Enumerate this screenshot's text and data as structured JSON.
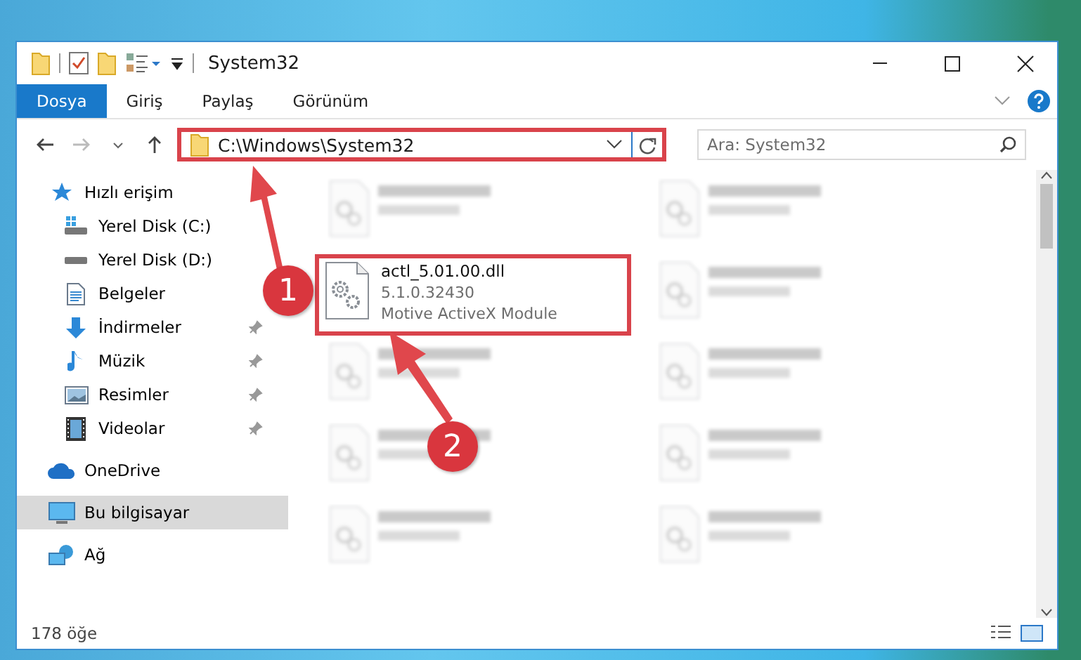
{
  "window": {
    "title": "System32"
  },
  "ribbon": {
    "tabs": [
      {
        "label": "Dosya",
        "selected": true
      },
      {
        "label": "Giriş",
        "selected": false
      },
      {
        "label": "Paylaş",
        "selected": false
      },
      {
        "label": "Görünüm",
        "selected": false
      }
    ]
  },
  "address_bar": {
    "path": "C:\\Windows\\System32",
    "highlighted": true
  },
  "search": {
    "placeholder": "Ara: System32"
  },
  "sidebar": {
    "sections": [
      {
        "label": "Hızlı erişim",
        "kind": "star",
        "selected": false,
        "children": [
          {
            "label": "Yerel Disk (C:)",
            "kind": "drive-c",
            "pinned": false,
            "selected": false
          },
          {
            "label": "Yerel Disk (D:)",
            "kind": "drive",
            "pinned": false,
            "selected": false
          },
          {
            "label": "Belgeler",
            "kind": "documents",
            "pinned": false,
            "selected": false
          },
          {
            "label": "İndirmeler",
            "kind": "downloads",
            "pinned": true,
            "selected": false
          },
          {
            "label": "Müzik",
            "kind": "music",
            "pinned": true,
            "selected": false
          },
          {
            "label": "Resimler",
            "kind": "pictures",
            "pinned": true,
            "selected": false
          },
          {
            "label": "Videolar",
            "kind": "videos",
            "pinned": true,
            "selected": false
          }
        ]
      },
      {
        "label": "OneDrive",
        "kind": "cloud",
        "selected": false
      },
      {
        "label": "Bu bilgisayar",
        "kind": "computer",
        "selected": true
      },
      {
        "label": "Ağ",
        "kind": "network",
        "selected": false
      }
    ]
  },
  "files": [
    {
      "kind": "blurred"
    },
    {
      "kind": "blurred"
    },
    {
      "kind": "file",
      "name": "actl_5.01.00.dll",
      "details": [
        "5.1.0.32430",
        "Motive ActiveX Module"
      ],
      "highlighted": true
    },
    {
      "kind": "blurred"
    },
    {
      "kind": "blurred"
    },
    {
      "kind": "blurred"
    },
    {
      "kind": "blurred"
    },
    {
      "kind": "blurred"
    },
    {
      "kind": "blurred"
    },
    {
      "kind": "blurred"
    }
  ],
  "status_bar": {
    "item_count": "178 öğe"
  },
  "annotations": [
    {
      "number": "1"
    },
    {
      "number": "2"
    }
  ]
}
